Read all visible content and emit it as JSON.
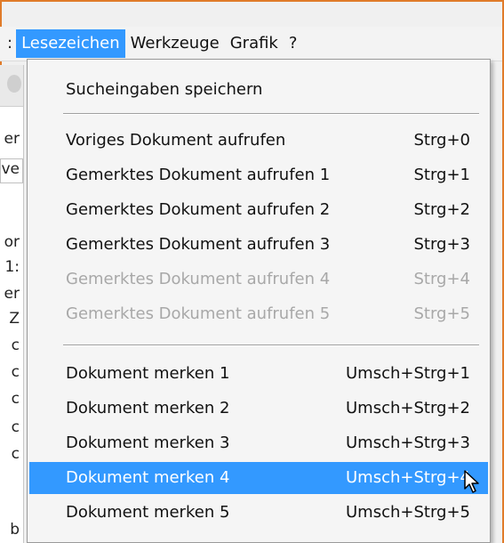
{
  "menubar": {
    "prev_partial": ":",
    "items": [
      {
        "label": "Lesezeichen",
        "active": true
      },
      {
        "label": "Werkzeuge",
        "active": false
      },
      {
        "label": "Grafik",
        "active": false
      },
      {
        "label": "?",
        "active": false
      }
    ]
  },
  "background_window": {
    "left_fragments": [
      "er",
      "ve",
      "or",
      "1:",
      "er",
      "Z",
      "c",
      "c",
      "c",
      "c",
      "c",
      "b"
    ]
  },
  "dropdown": {
    "save_search": {
      "label": "Sucheingaben speichern"
    },
    "group1": [
      {
        "label": "Voriges Dokument aufrufen",
        "shortcut": "Strg+0",
        "enabled": true
      },
      {
        "label": "Gemerktes Dokument aufrufen 1",
        "shortcut": "Strg+1",
        "enabled": true
      },
      {
        "label": "Gemerktes Dokument aufrufen 2",
        "shortcut": "Strg+2",
        "enabled": true
      },
      {
        "label": "Gemerktes Dokument aufrufen 3",
        "shortcut": "Strg+3",
        "enabled": true
      },
      {
        "label": "Gemerktes Dokument aufrufen 4",
        "shortcut": "Strg+4",
        "enabled": false
      },
      {
        "label": "Gemerktes Dokument aufrufen 5",
        "shortcut": "Strg+5",
        "enabled": false
      }
    ],
    "group2": [
      {
        "label": "Dokument merken 1",
        "shortcut": "Umsch+Strg+1"
      },
      {
        "label": "Dokument merken 2",
        "shortcut": "Umsch+Strg+2"
      },
      {
        "label": "Dokument merken 3",
        "shortcut": "Umsch+Strg+3"
      },
      {
        "label": "Dokument merken 4",
        "shortcut": "Umsch+Strg+4",
        "highlighted": true
      },
      {
        "label": "Dokument merken 5",
        "shortcut": "Umsch+Strg+5"
      }
    ]
  },
  "colors": {
    "highlight": "#3399ff",
    "frame_border": "#e07b2a",
    "disabled_text": "#a8a8a8"
  },
  "icons": {
    "cursor": "arrow-cursor-icon"
  }
}
